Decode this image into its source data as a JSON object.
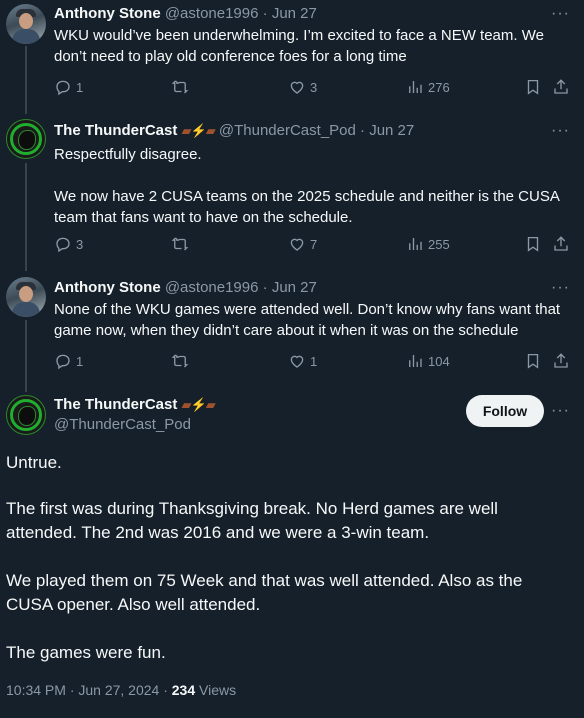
{
  "replies": [
    {
      "name": "Anthony Stone",
      "handle": "@astone1996",
      "separator": "·",
      "time": "Jun 27",
      "text": "WKU would’ve been underwhelming. I’m excited to face a NEW team. We don’t need to play old conference foes for a long time",
      "replies_count": "1",
      "likes": "3",
      "views": "276"
    },
    {
      "name": "The ThunderCast",
      "handle": "@ThunderCast_Pod",
      "separator": "·",
      "time": "Jun 27",
      "text": "Respectfully disagree.\n\nWe now have 2 CUSA teams on the 2025 schedule and neither is the CUSA team that fans want to have on the schedule.",
      "replies_count": "3",
      "likes": "7",
      "views": "255"
    },
    {
      "name": "Anthony Stone",
      "handle": "@astone1996",
      "separator": "·",
      "time": "Jun 27",
      "text": "None of the WKU games were attended well. Don’t know why fans want that game now, when they didn’t care about it when it was on the schedule",
      "replies_count": "1",
      "likes": "1",
      "views": "104"
    }
  ],
  "main": {
    "name": "The ThunderCast",
    "handle": "@ThunderCast_Pod",
    "follow_label": "Follow",
    "paragraphs": [
      "Untrue.",
      "The first was during Thanksgiving break. No Herd games are well attended. The 2nd was 2016 and we were a 3-win team.",
      "We played them on 75 Week and that was well attended. Also as the CUSA opener. Also well attended.",
      "The games were fun."
    ],
    "time": "10:34 PM · Jun 27, 2024 · ",
    "views_count": "234",
    "views_label": " Views"
  },
  "icons": {
    "reply": "reply-icon",
    "retweet": "retweet-icon",
    "like": "heart-icon",
    "views": "views-icon",
    "bookmark": "bookmark-icon",
    "share": "share-icon",
    "more": "more-icon"
  },
  "colors": {
    "background": "#15202b",
    "text": "#f7f9f9",
    "muted": "#8b98a5",
    "follow_bg": "#eff3f4"
  }
}
